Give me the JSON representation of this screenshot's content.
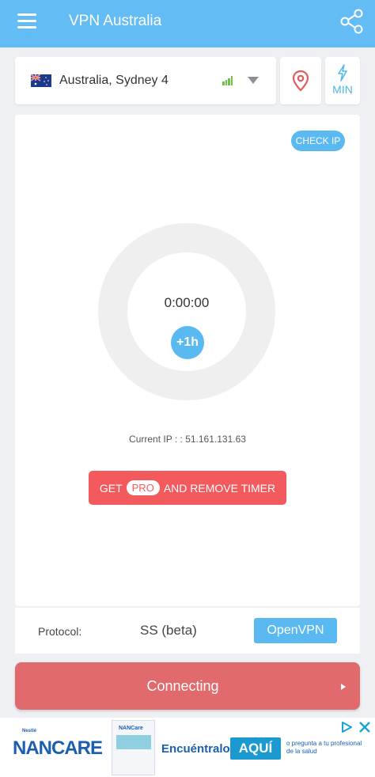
{
  "appbar": {
    "title": "VPN Australia",
    "menu_icon": "hamburger-menu-icon",
    "share_icon": "share-icon",
    "color": "#63bcf3"
  },
  "server": {
    "name": "Australia, Sydney 4",
    "flag_icon": "australia-flag-icon",
    "signal_icon": "signal-strength-icon",
    "signal_color": "#6fc04a",
    "dropdown_icon": "dropdown-arrow-icon"
  },
  "location_button": {
    "icon": "location-pin-icon"
  },
  "min_button": {
    "icon": "lightning-icon",
    "label": "MIN"
  },
  "main": {
    "check_ip_label": "CHECK IP",
    "timer": "0:00:00",
    "add_time_label": "+1h",
    "current_ip_label": "Current IP :",
    "current_ip_value": ": 51.161.131.63",
    "pro_button": {
      "prefix": "GET",
      "badge": "PRO",
      "suffix": "AND REMOVE TIMER",
      "color": "#f35a5e"
    }
  },
  "protocol": {
    "label": "Protocol:",
    "options": [
      "SS (beta)",
      "OpenVPN"
    ],
    "selected": "OpenVPN"
  },
  "connect_button": {
    "label": "Connecting",
    "arrow_icon": "play-arrow-icon",
    "color": "#e06a6c"
  },
  "ad": {
    "brand_small": "Nestlé",
    "brand": "NANCARE",
    "product_label": "NANCare",
    "cta": "Encuéntralo",
    "cta_highlight": "AQUÍ",
    "note": "o pregunta a tu profesional de la salud",
    "choices_icon": "adchoices-icon",
    "close_icon": "close-icon"
  }
}
